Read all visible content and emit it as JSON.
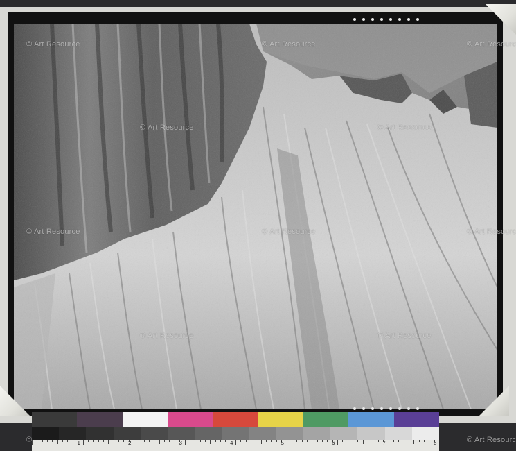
{
  "watermark": {
    "text": "© Art Resource"
  },
  "color_target": {
    "colors": [
      "#3a3a3a",
      "#4b3d4d",
      "#f3f3f3",
      "#d94a8c",
      "#d6493c",
      "#e7d348",
      "#4f9a63",
      "#5b97d6",
      "#5a3f96"
    ],
    "gray_steps": [
      "#1b1b1b",
      "#262626",
      "#313131",
      "#3d3d3d",
      "#4a4a4a",
      "#575757",
      "#656565",
      "#747474",
      "#838383",
      "#939393",
      "#a4a4a4",
      "#b5b5b5",
      "#c7c7c7",
      "#d8d8d8",
      "#ececec"
    ],
    "scale_numbers": [
      "1",
      "2",
      "3",
      "4",
      "5",
      "6",
      "7",
      "8"
    ]
  }
}
